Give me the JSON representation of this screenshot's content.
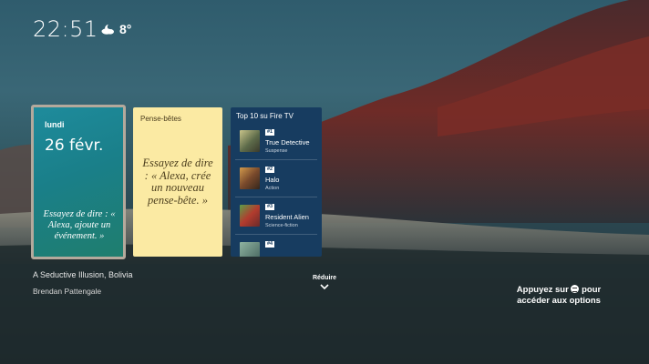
{
  "clock": "22:51",
  "weather": {
    "temp": "8°",
    "icon": "partly-cloudy-night-icon"
  },
  "date_card": {
    "day": "lundi",
    "date": "26 févr.",
    "tip": "Essayez de dire : « Alexa, ajoute un événement. »"
  },
  "notes_card": {
    "title": "Pense-bêtes",
    "tip": "Essayez de dire : « Alexa, crée un nouveau pense-bête. »"
  },
  "top10_card": {
    "title": "Top 10 su Fire TV",
    "items": [
      {
        "rank": "#1",
        "title": "True Detective",
        "genre": "Suspense"
      },
      {
        "rank": "#2",
        "title": "Halo",
        "genre": "Action"
      },
      {
        "rank": "#3",
        "title": "Resident Alien",
        "genre": "Science-fiction"
      },
      {
        "rank": "#4",
        "title": "",
        "genre": ""
      }
    ]
  },
  "photo_caption": {
    "title": "A Seductive Illusion, Bolivia",
    "author": "Brendan Pattengale"
  },
  "collapse": {
    "label": "Réduire"
  },
  "hint": {
    "line1_before": "Appuyez sur",
    "line1_after": "pour",
    "line2": "accéder aux options"
  },
  "colors": {
    "date_card": "#1e8b9c",
    "notes_card": "#fbeaa3",
    "top10_card": "#173c60"
  }
}
